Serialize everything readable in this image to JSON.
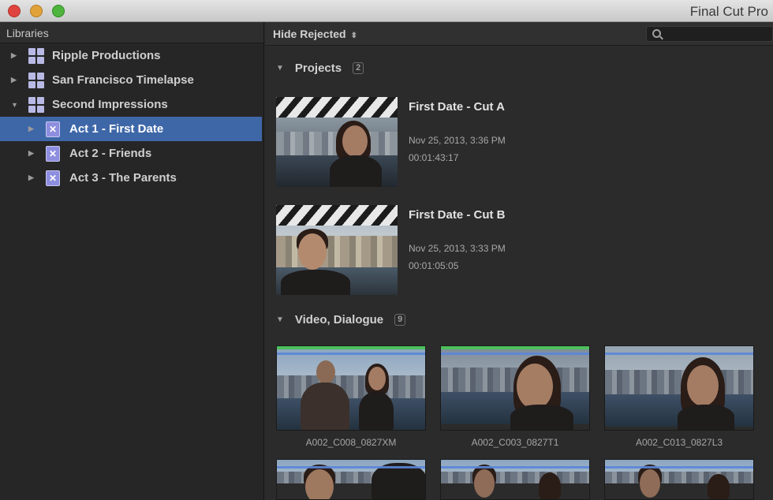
{
  "window": {
    "title": "Final Cut Pro"
  },
  "sidebar": {
    "header": "Libraries",
    "items": [
      {
        "label": "Ripple Productions",
        "type": "library",
        "level": 0,
        "expanded": false,
        "selected": false
      },
      {
        "label": "San Francisco Timelapse",
        "type": "library",
        "level": 0,
        "expanded": false,
        "selected": false
      },
      {
        "label": "Second Impressions",
        "type": "library",
        "level": 0,
        "expanded": true,
        "selected": false
      },
      {
        "label": "Act 1 - First Date",
        "type": "event",
        "level": 1,
        "expanded": false,
        "selected": true
      },
      {
        "label": "Act 2 - Friends",
        "type": "event",
        "level": 1,
        "expanded": false,
        "selected": false
      },
      {
        "label": "Act 3 - The Parents",
        "type": "event",
        "level": 1,
        "expanded": false,
        "selected": false
      }
    ]
  },
  "browser": {
    "filter_label": "Hide Rejected",
    "search": {
      "placeholder": ""
    },
    "projects_section": {
      "label": "Projects",
      "count": "2",
      "items": [
        {
          "name": "First Date - Cut A",
          "date": "Nov 25, 2013, 3:36 PM",
          "duration": "00:01:43:17"
        },
        {
          "name": "First Date - Cut B",
          "date": "Nov 25, 2013, 3:33 PM",
          "duration": "00:01:05:05"
        }
      ]
    },
    "clips_section": {
      "label": "Video, Dialogue",
      "count": "9",
      "clips": [
        {
          "name": "A002_C008_0827XM"
        },
        {
          "name": "A002_C003_0827T1"
        },
        {
          "name": "A002_C013_0827L3"
        }
      ]
    }
  },
  "colors": {
    "selection": "#3e67a8",
    "favorite_tag": "#4cc05a",
    "keyword_bar": "#5b86d8"
  }
}
